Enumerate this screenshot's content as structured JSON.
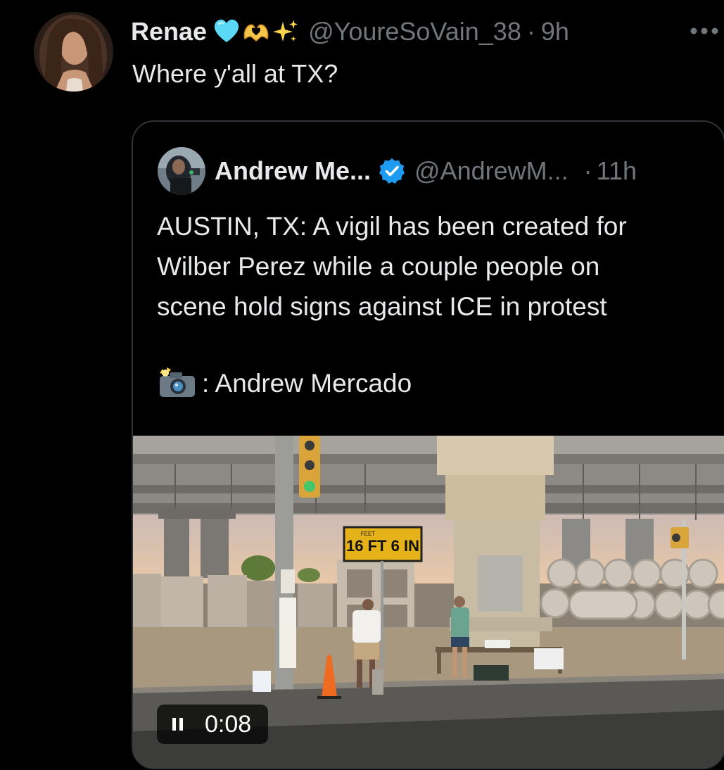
{
  "tweet": {
    "display_name": "Renae",
    "emoji_icons": [
      "blue-heart-icon",
      "heart-hands-icon",
      "sparkles-icon"
    ],
    "handle": "@YoureSoVain_38",
    "separator": "·",
    "time": "9h",
    "more_icon": "ellipsis-icon",
    "text": "Where y'all at TX?"
  },
  "quoted_tweet": {
    "display_name": "Andrew Me...",
    "verified_icon": "verified-badge-icon",
    "handle": "@AndrewM...",
    "separator": "·",
    "time": "11h",
    "text_lines": [
      "AUSTIN, TX: A vigil has been created for",
      "Wilber Perez while a couple people on",
      "scene hold signs against ICE in protest"
    ],
    "credit_icon": "camera-flash-icon",
    "credit_text": ": Andrew Mercado",
    "media": {
      "type": "video",
      "state_icon": "pause-icon",
      "elapsed": "0:08",
      "sign_clearance": "16 FT 6 IN",
      "sign_clearance_small": "FEET"
    }
  },
  "colors": {
    "background": "#000000",
    "text_primary": "#e7e9ea",
    "text_secondary": "#71767b",
    "card_border": "#2f3336",
    "verified_blue": "#1d9bf0",
    "heart_cyan": "#5ad8f5"
  }
}
